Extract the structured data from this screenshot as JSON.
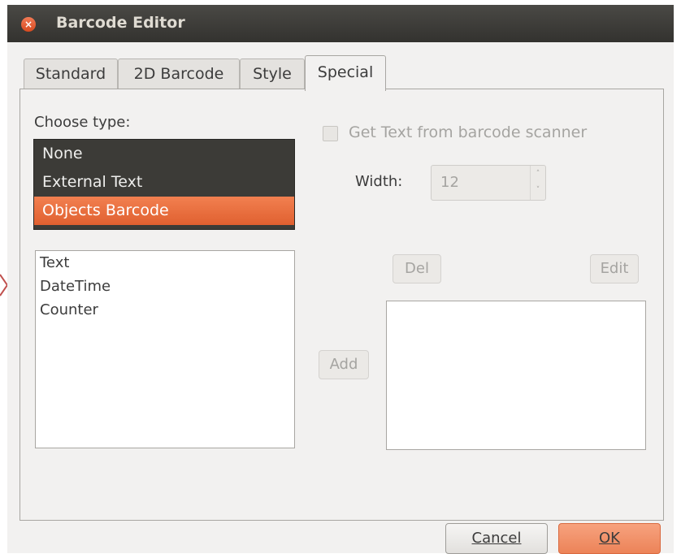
{
  "window": {
    "title": "Barcode Editor",
    "close_glyph": "×"
  },
  "tabs": [
    {
      "label": "Standard",
      "active": false
    },
    {
      "label": "2D Barcode",
      "active": false
    },
    {
      "label": "Style",
      "active": false
    },
    {
      "label": "Special",
      "active": true
    }
  ],
  "special": {
    "choose_type_label": "Choose type:",
    "types": [
      "None",
      "External Text",
      "Objects Barcode"
    ],
    "selected_type": "Objects Barcode",
    "scanner_checkbox_label": "Get Text from barcode scanner",
    "scanner_checked": false,
    "width_label": "Width:",
    "width_value": "12",
    "objects": [
      "Text",
      "DateTime",
      "Counter"
    ],
    "add_label": "Add",
    "del_label": "Del",
    "edit_label": "Edit"
  },
  "footer": {
    "cancel_label": "Cancel",
    "ok_label": "OK"
  },
  "colors": {
    "accent": "#e8703d",
    "titlebar": "#3a3935",
    "list_dark": "#3c3b37"
  }
}
